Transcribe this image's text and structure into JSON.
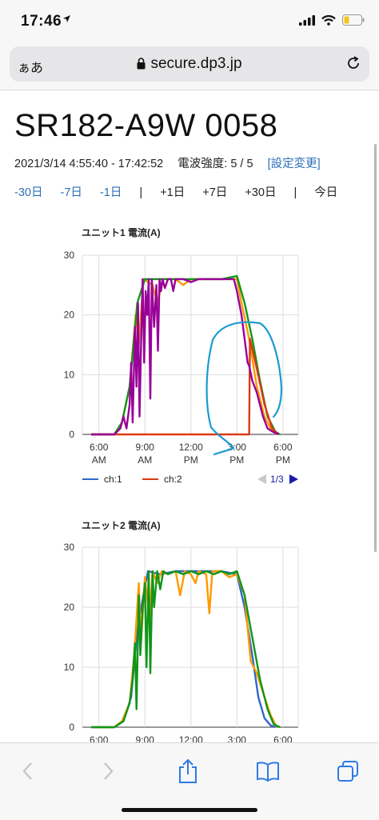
{
  "status": {
    "time": "17:46"
  },
  "browser": {
    "aa_label": "ぁあ",
    "url": "secure.dp3.jp"
  },
  "page": {
    "title": "SR182-A9W 0058",
    "range": "2021/3/14 4:55:40 - 17:42:52",
    "signal": "電波強度: 5 / 5",
    "settings_link": "[設定変更]",
    "nav": {
      "m30": "-30日",
      "m7": "-7日",
      "m1": "-1日",
      "sep": "|",
      "p1": "+1日",
      "p7": "+7日",
      "p30": "+30日",
      "today": "今日"
    }
  },
  "chart_data": [
    {
      "type": "line",
      "title": "ユニット1 電流(A)",
      "x_ticks": [
        [
          "6:00",
          "AM"
        ],
        [
          "9:00",
          "AM"
        ],
        [
          "12:00",
          "PM"
        ],
        [
          "3:00",
          "PM"
        ],
        [
          "6:00",
          "PM"
        ]
      ],
      "x_tick_hours": [
        6,
        9,
        12,
        15,
        18
      ],
      "xlim": [
        4.92,
        19.0
      ],
      "ylim": [
        0,
        30
      ],
      "y_ticks": [
        0,
        10,
        20,
        30
      ],
      "legend": {
        "items": [
          {
            "name": "ch:1",
            "color": "#3366cc"
          },
          {
            "name": "ch:2",
            "color": "#dc3912"
          }
        ],
        "page": "1/3",
        "position": "bottom"
      },
      "series": [
        {
          "color": "#ff9900",
          "points": [
            [
              5.5,
              0
            ],
            [
              7.0,
              0
            ],
            [
              7.5,
              2
            ],
            [
              8.0,
              8
            ],
            [
              8.4,
              20
            ],
            [
              8.6,
              15
            ],
            [
              8.9,
              26
            ],
            [
              9.5,
              25
            ],
            [
              9.8,
              22
            ],
            [
              10.2,
              26
            ],
            [
              11.0,
              26
            ],
            [
              11.5,
              25
            ],
            [
              12.0,
              26
            ],
            [
              13.0,
              26
            ],
            [
              14.0,
              26
            ],
            [
              15.0,
              26
            ],
            [
              15.3,
              22
            ],
            [
              15.8,
              16
            ],
            [
              16.3,
              8
            ],
            [
              16.8,
              3
            ],
            [
              17.2,
              1
            ],
            [
              17.6,
              0
            ]
          ]
        },
        {
          "color": "#109618",
          "points": [
            [
              5.5,
              0
            ],
            [
              7.0,
              0
            ],
            [
              7.5,
              2
            ],
            [
              8.0,
              8
            ],
            [
              8.5,
              22
            ],
            [
              9.0,
              26
            ],
            [
              10.0,
              26
            ],
            [
              11.0,
              26
            ],
            [
              12.0,
              26
            ],
            [
              13.0,
              26
            ],
            [
              14.0,
              26
            ],
            [
              15.0,
              26.5
            ],
            [
              15.5,
              22
            ],
            [
              16.0,
              16
            ],
            [
              16.5,
              9
            ],
            [
              17.0,
              3
            ],
            [
              17.5,
              0.5
            ],
            [
              17.8,
              0
            ]
          ]
        },
        {
          "color": "#dc3912",
          "points": [
            [
              5.5,
              0
            ],
            [
              14.5,
              0
            ],
            [
              15.8,
              0
            ],
            [
              15.85,
              16
            ],
            [
              16.3,
              11
            ],
            [
              16.8,
              5
            ],
            [
              17.3,
              1
            ],
            [
              17.7,
              0
            ]
          ]
        },
        {
          "color": "#990099",
          "points": [
            [
              5.5,
              0
            ],
            [
              7.0,
              0
            ],
            [
              7.4,
              1
            ],
            [
              7.6,
              3
            ],
            [
              7.8,
              1
            ],
            [
              8.0,
              5
            ],
            [
              8.1,
              12
            ],
            [
              8.2,
              2
            ],
            [
              8.35,
              18
            ],
            [
              8.45,
              8
            ],
            [
              8.55,
              22
            ],
            [
              8.65,
              3
            ],
            [
              8.75,
              15
            ],
            [
              8.85,
              26
            ],
            [
              8.95,
              12
            ],
            [
              9.05,
              24
            ],
            [
              9.15,
              20
            ],
            [
              9.25,
              26
            ],
            [
              9.35,
              6
            ],
            [
              9.45,
              26
            ],
            [
              9.6,
              18
            ],
            [
              9.75,
              25
            ],
            [
              9.85,
              14
            ],
            [
              9.95,
              26
            ],
            [
              10.05,
              24
            ],
            [
              10.15,
              26
            ],
            [
              10.3,
              24.5
            ],
            [
              10.5,
              26
            ],
            [
              10.7,
              26
            ],
            [
              10.85,
              24
            ],
            [
              11.0,
              26
            ],
            [
              11.5,
              26
            ],
            [
              12.0,
              25.5
            ],
            [
              12.5,
              26
            ],
            [
              13.0,
              26
            ],
            [
              13.5,
              26
            ],
            [
              14.0,
              26
            ],
            [
              14.5,
              26
            ],
            [
              14.8,
              26
            ],
            [
              15.0,
              24
            ],
            [
              15.3,
              20
            ],
            [
              15.5,
              16
            ],
            [
              15.7,
              12
            ],
            [
              15.8,
              11.5
            ],
            [
              16.0,
              9
            ],
            [
              16.3,
              7
            ],
            [
              16.7,
              3
            ],
            [
              17.0,
              1
            ],
            [
              17.3,
              0.5
            ],
            [
              17.7,
              0
            ]
          ]
        }
      ],
      "annotation": {
        "type": "hand-drawn-circle",
        "color": "#1a9bd0"
      }
    },
    {
      "type": "line",
      "title": "ユニット2 電流(A)",
      "x_ticks": [
        [
          "6:00",
          ""
        ],
        [
          "9:00",
          ""
        ],
        [
          "12:00",
          ""
        ],
        [
          "3:00",
          ""
        ],
        [
          "6:00",
          ""
        ]
      ],
      "x_tick_hours": [
        6,
        9,
        12,
        15,
        18
      ],
      "xlim": [
        4.92,
        19.0
      ],
      "ylim": [
        0,
        30
      ],
      "y_ticks": [
        0,
        10,
        20,
        30
      ],
      "series": [
        {
          "color": "#3366cc",
          "points": [
            [
              5.5,
              0
            ],
            [
              7.0,
              0
            ],
            [
              7.6,
              1
            ],
            [
              8.1,
              5
            ],
            [
              8.5,
              16
            ],
            [
              8.9,
              22
            ],
            [
              9.2,
              26
            ],
            [
              10.0,
              25.5
            ],
            [
              11.0,
              26
            ],
            [
              12.0,
              26
            ],
            [
              13.0,
              26
            ],
            [
              14.0,
              26
            ],
            [
              15.0,
              25.5
            ],
            [
              15.5,
              20
            ],
            [
              16.0,
              12
            ],
            [
              16.4,
              5
            ],
            [
              16.8,
              1.5
            ],
            [
              17.2,
              0.3
            ],
            [
              17.5,
              0
            ]
          ]
        },
        {
          "color": "#ff9900",
          "points": [
            [
              5.5,
              0
            ],
            [
              7.0,
              0
            ],
            [
              7.5,
              1
            ],
            [
              8.0,
              4
            ],
            [
              8.3,
              12
            ],
            [
              8.6,
              24
            ],
            [
              8.75,
              14
            ],
            [
              9.0,
              25
            ],
            [
              9.3,
              18
            ],
            [
              9.5,
              26
            ],
            [
              9.8,
              24
            ],
            [
              10.1,
              26
            ],
            [
              10.5,
              25.5
            ],
            [
              11.0,
              26
            ],
            [
              11.3,
              22
            ],
            [
              11.6,
              26
            ],
            [
              12.0,
              25.5
            ],
            [
              12.3,
              24
            ],
            [
              12.5,
              26
            ],
            [
              13.0,
              25.5
            ],
            [
              13.2,
              19
            ],
            [
              13.4,
              26
            ],
            [
              14.0,
              26
            ],
            [
              14.5,
              25
            ],
            [
              15.0,
              25.5
            ],
            [
              15.5,
              22
            ],
            [
              15.9,
              11
            ],
            [
              16.3,
              9
            ],
            [
              16.8,
              5
            ],
            [
              17.2,
              2
            ],
            [
              17.6,
              0
            ]
          ]
        },
        {
          "color": "#109618",
          "points": [
            [
              5.5,
              0
            ],
            [
              7.0,
              0
            ],
            [
              7.6,
              1
            ],
            [
              8.0,
              4
            ],
            [
              8.2,
              8
            ],
            [
              8.35,
              14
            ],
            [
              8.45,
              3
            ],
            [
              8.6,
              22
            ],
            [
              8.7,
              12
            ],
            [
              8.85,
              20
            ],
            [
              9.0,
              24
            ],
            [
              9.1,
              10
            ],
            [
              9.25,
              26
            ],
            [
              9.35,
              9
            ],
            [
              9.5,
              26
            ],
            [
              9.6,
              20
            ],
            [
              9.8,
              26
            ],
            [
              10.0,
              23
            ],
            [
              10.2,
              26
            ],
            [
              10.5,
              25.5
            ],
            [
              11.0,
              26
            ],
            [
              11.5,
              25.5
            ],
            [
              12.0,
              26
            ],
            [
              12.5,
              25.5
            ],
            [
              13.0,
              26
            ],
            [
              13.5,
              25.5
            ],
            [
              14.0,
              26
            ],
            [
              14.5,
              25.5
            ],
            [
              15.0,
              26
            ],
            [
              15.5,
              22
            ],
            [
              16.0,
              15
            ],
            [
              16.5,
              8
            ],
            [
              17.0,
              3
            ],
            [
              17.4,
              0.5
            ],
            [
              17.8,
              0
            ]
          ]
        }
      ]
    }
  ]
}
